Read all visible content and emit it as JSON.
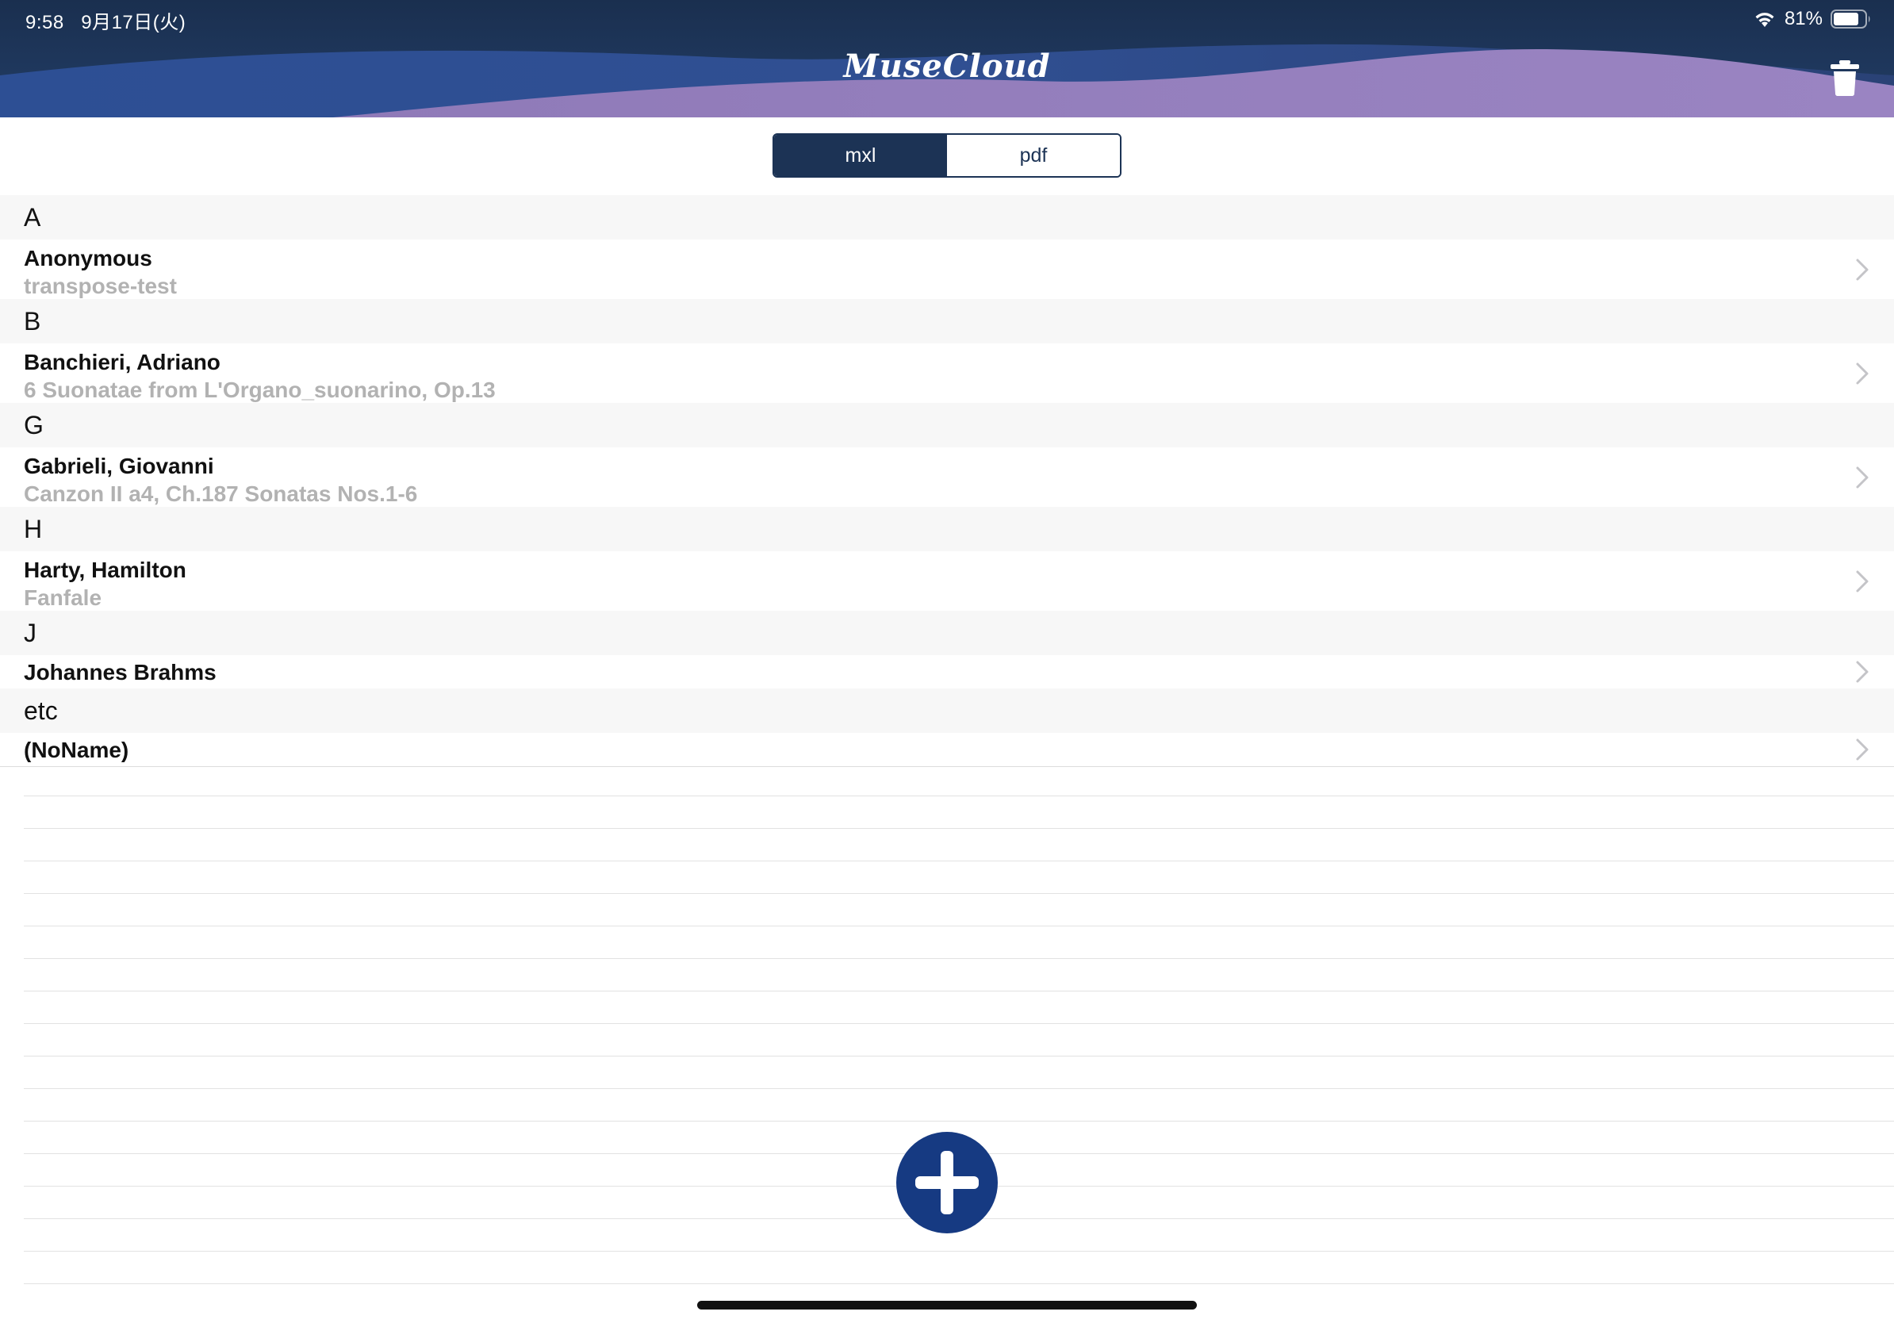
{
  "status_bar": {
    "time": "9:58",
    "date": "9月17日(火)",
    "battery_percent": "81%",
    "battery_level": 0.81,
    "wifi_icon": "wifi-icon",
    "battery_icon": "battery-icon"
  },
  "header": {
    "logo": "MuseCloud",
    "trash_icon": "trash-icon",
    "colors": {
      "navy": "#1c3355",
      "purple": "#9b82c0",
      "pink": "#e59ac2"
    }
  },
  "segmented_control": {
    "options": [
      "mxl",
      "pdf"
    ],
    "selected": "mxl"
  },
  "sections": [
    {
      "letter": "A",
      "items": [
        {
          "name": "Anonymous",
          "subtitle": "transpose-test"
        }
      ]
    },
    {
      "letter": "B",
      "items": [
        {
          "name": "Banchieri, Adriano",
          "subtitle": "6 Suonatae from L'Organo_suonarino, Op.13"
        }
      ]
    },
    {
      "letter": "G",
      "items": [
        {
          "name": "Gabrieli, Giovanni",
          "subtitle": "Canzon II a4, Ch.187 Sonatas Nos.1-6"
        }
      ]
    },
    {
      "letter": "H",
      "items": [
        {
          "name": "Harty, Hamilton",
          "subtitle": "Fanfale"
        }
      ]
    },
    {
      "letter": "J",
      "items": [
        {
          "name": "Johannes Brahms",
          "subtitle": ""
        }
      ]
    },
    {
      "letter": "etc",
      "items": [
        {
          "name": "(NoName)",
          "subtitle": ""
        }
      ]
    }
  ],
  "fab": {
    "icon": "plus-icon",
    "color": "#163a82"
  }
}
